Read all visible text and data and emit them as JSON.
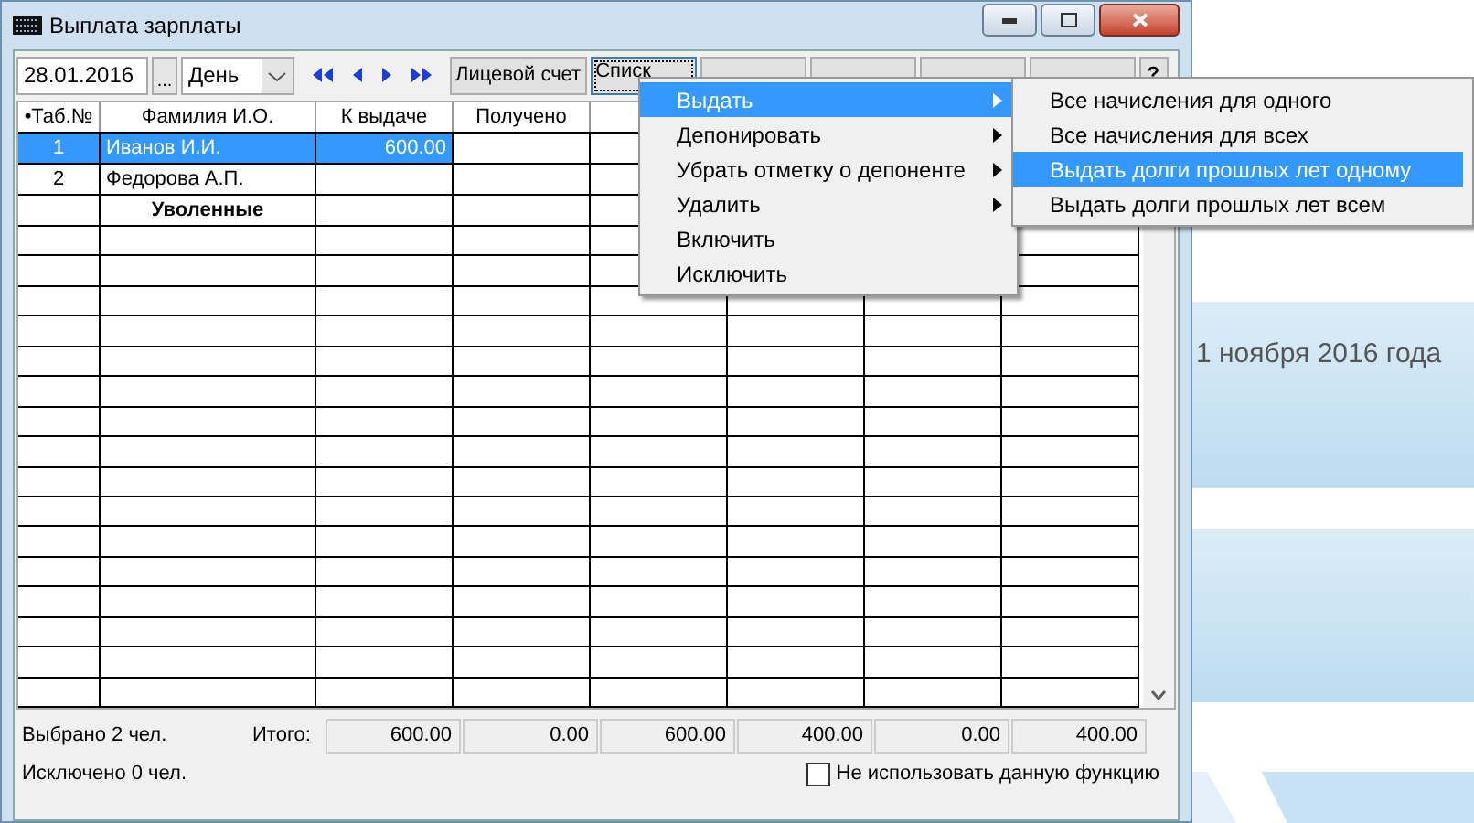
{
  "window": {
    "title": "Выплата зарплаты"
  },
  "toolbar": {
    "date": "28.01.2016",
    "browse": "...",
    "period": "День",
    "buttons": [
      {
        "label": "Лицевой счет",
        "focused": false
      },
      {
        "label": "Списк",
        "focused": true
      },
      {
        "focused": false
      },
      {
        "focused": false
      },
      {
        "focused": false
      },
      {
        "focused": false
      },
      {
        "label": "?",
        "focused": false
      }
    ]
  },
  "table": {
    "columns": [
      "•Таб.№",
      "Фамилия И.О.",
      "К выдаче",
      "Получено"
    ],
    "rows": [
      {
        "kind": "person",
        "tab": "1",
        "name": "Иванов И.И.",
        "amount": "600.00",
        "selected": true
      },
      {
        "kind": "person",
        "tab": "2",
        "name": "Федорова А.П.",
        "selected": false
      },
      {
        "kind": "group",
        "name": "Уволенные",
        "selected": false
      }
    ]
  },
  "footer": {
    "selected_count": "Выбрано 2 чел.",
    "excluded_count": "Исключено 0 чел.",
    "total_label": "Итого:",
    "totals": [
      "600.00",
      "0.00",
      "600.00",
      "400.00",
      "0.00",
      "400.00"
    ],
    "option": {
      "label": "Не использовать данную функцию",
      "checked": false
    }
  },
  "menu": [
    {
      "label": "Выдать",
      "submenu": true,
      "selected": true
    },
    {
      "label": "Депонировать",
      "submenu": true,
      "selected": false
    },
    {
      "label": "Убрать отметку о депоненте",
      "submenu": true,
      "selected": false
    },
    {
      "label": "Удалить",
      "submenu": true,
      "selected": false
    },
    {
      "label": "Включить",
      "submenu": false,
      "selected": false
    },
    {
      "label": "Исключить",
      "submenu": false,
      "selected": false
    }
  ],
  "submenu": [
    {
      "label": "Все начисления для одного",
      "selected": false
    },
    {
      "label": "Все начисления для всех",
      "selected": false
    },
    {
      "label": "Выдать долги прошлых лет одному",
      "selected": true
    },
    {
      "label": "Выдать долги прошлых лет всем",
      "selected": false
    }
  ],
  "background": {
    "date_text": "1 ноября 2016 года"
  }
}
